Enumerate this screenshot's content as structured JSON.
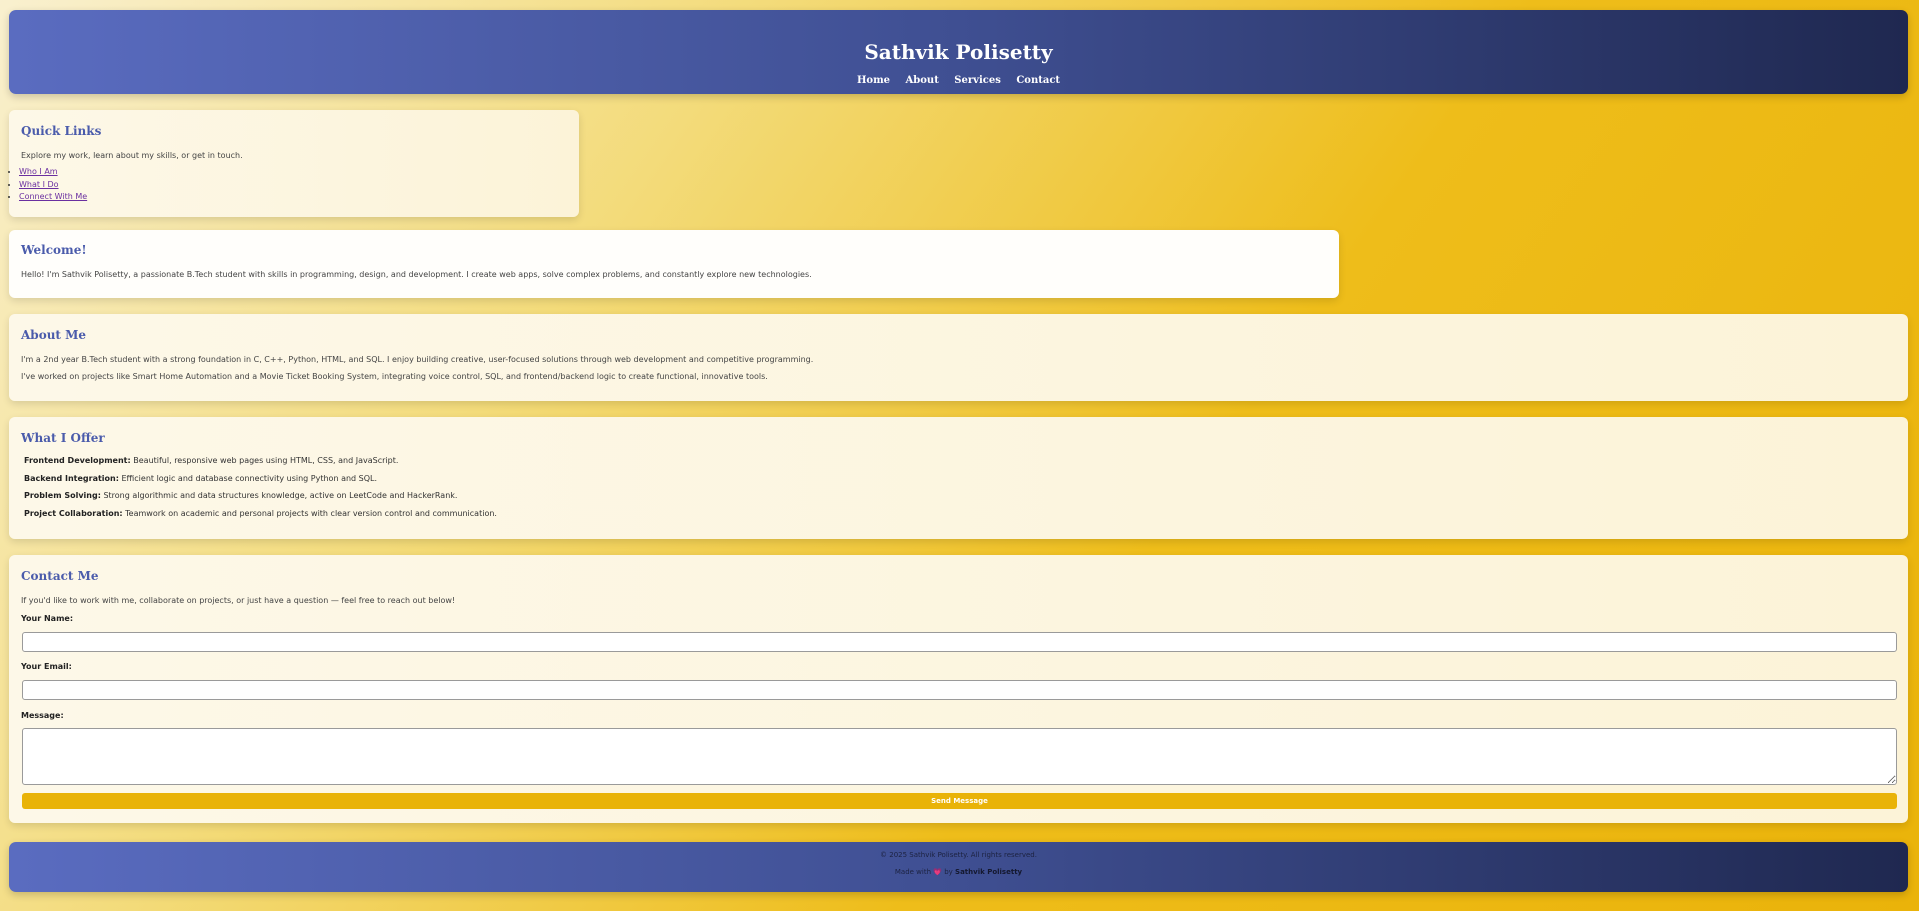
{
  "header": {
    "title": "Sathvik Polisetty",
    "nav": [
      "Home",
      "About",
      "Services",
      "Contact"
    ]
  },
  "quick_links": {
    "title": "Quick Links",
    "text": "Explore my work, learn about my skills, or get in touch.",
    "links": [
      "Who I Am",
      "What I Do",
      "Connect With Me"
    ]
  },
  "welcome": {
    "title": "Welcome!",
    "text": "Hello! I'm Sathvik Polisetty, a passionate B.Tech student with skills in programming, design, and development. I create web apps, solve complex problems, and constantly explore new technologies."
  },
  "about": {
    "title": "About Me",
    "p1": "I'm a 2nd year B.Tech student with a strong foundation in C, C++, Python, HTML, and SQL. I enjoy building creative, user-focused solutions through web development and competitive programming.",
    "p2": "I've worked on projects like Smart Home Automation and a Movie Ticket Booking System, integrating voice control, SQL, and frontend/backend logic to create functional, innovative tools."
  },
  "offer": {
    "title": "What I Offer",
    "items": [
      {
        "label": "Frontend Development:",
        "text": "Beautiful, responsive web pages using HTML, CSS, and JavaScript."
      },
      {
        "label": "Backend Integration:",
        "text": "Efficient logic and database connectivity using Python and SQL."
      },
      {
        "label": "Problem Solving:",
        "text": "Strong algorithmic and data structures knowledge, active on LeetCode and HackerRank."
      },
      {
        "label": "Project Collaboration:",
        "text": "Teamwork on academic and personal projects with clear version control and communication."
      }
    ]
  },
  "contact": {
    "title": "Contact Me",
    "intro": "If you'd like to work with me, collaborate on projects, or just have a question — feel free to reach out below!",
    "name_label": "Your Name:",
    "name_value": "",
    "email_label": "Your Email:",
    "email_value": "",
    "message_label": "Message:",
    "message_value": "",
    "send_label": "Send Message"
  },
  "footer": {
    "copyright": "© 2025 Sathvik Polisetty. All rights reserved.",
    "made_prefix": "Made with",
    "heart": "💗",
    "made_by": "by",
    "author": "Sathvik Polisetty"
  }
}
